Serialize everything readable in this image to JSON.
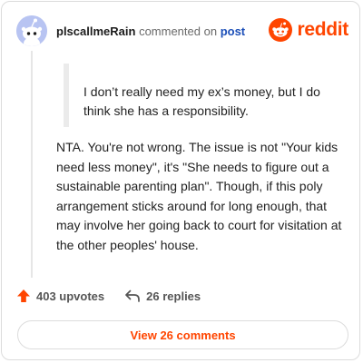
{
  "header": {
    "username": "plscallmeRain",
    "action": "commented on",
    "post_link": "post",
    "avatar_icon": "snoo-avatar-icon",
    "brand": {
      "icon": "reddit-snoo-icon",
      "wordmark": "reddit",
      "color": "#ff4500"
    }
  },
  "quote": {
    "text": "I don’t really need my ex’s money, but I do think she has a responsibility."
  },
  "comment": {
    "text": "NTA. You're not wrong. The issue is not \"Your kids need less money\", it's \"She needs to figure out a sustainable parenting plan\". Though, if this poly arrangement sticks around for long enough, that may involve her going back to court for visitation at the other peoples' house."
  },
  "footer": {
    "upvotes_label": "403 upvotes",
    "upvote_icon": "upvote-arrow-icon",
    "upvote_color": "#ff4500",
    "replies_label": "26 replies",
    "reply_icon": "reply-arrow-icon"
  },
  "view_button": {
    "label": "View 26 comments",
    "color": "#ff4500"
  }
}
